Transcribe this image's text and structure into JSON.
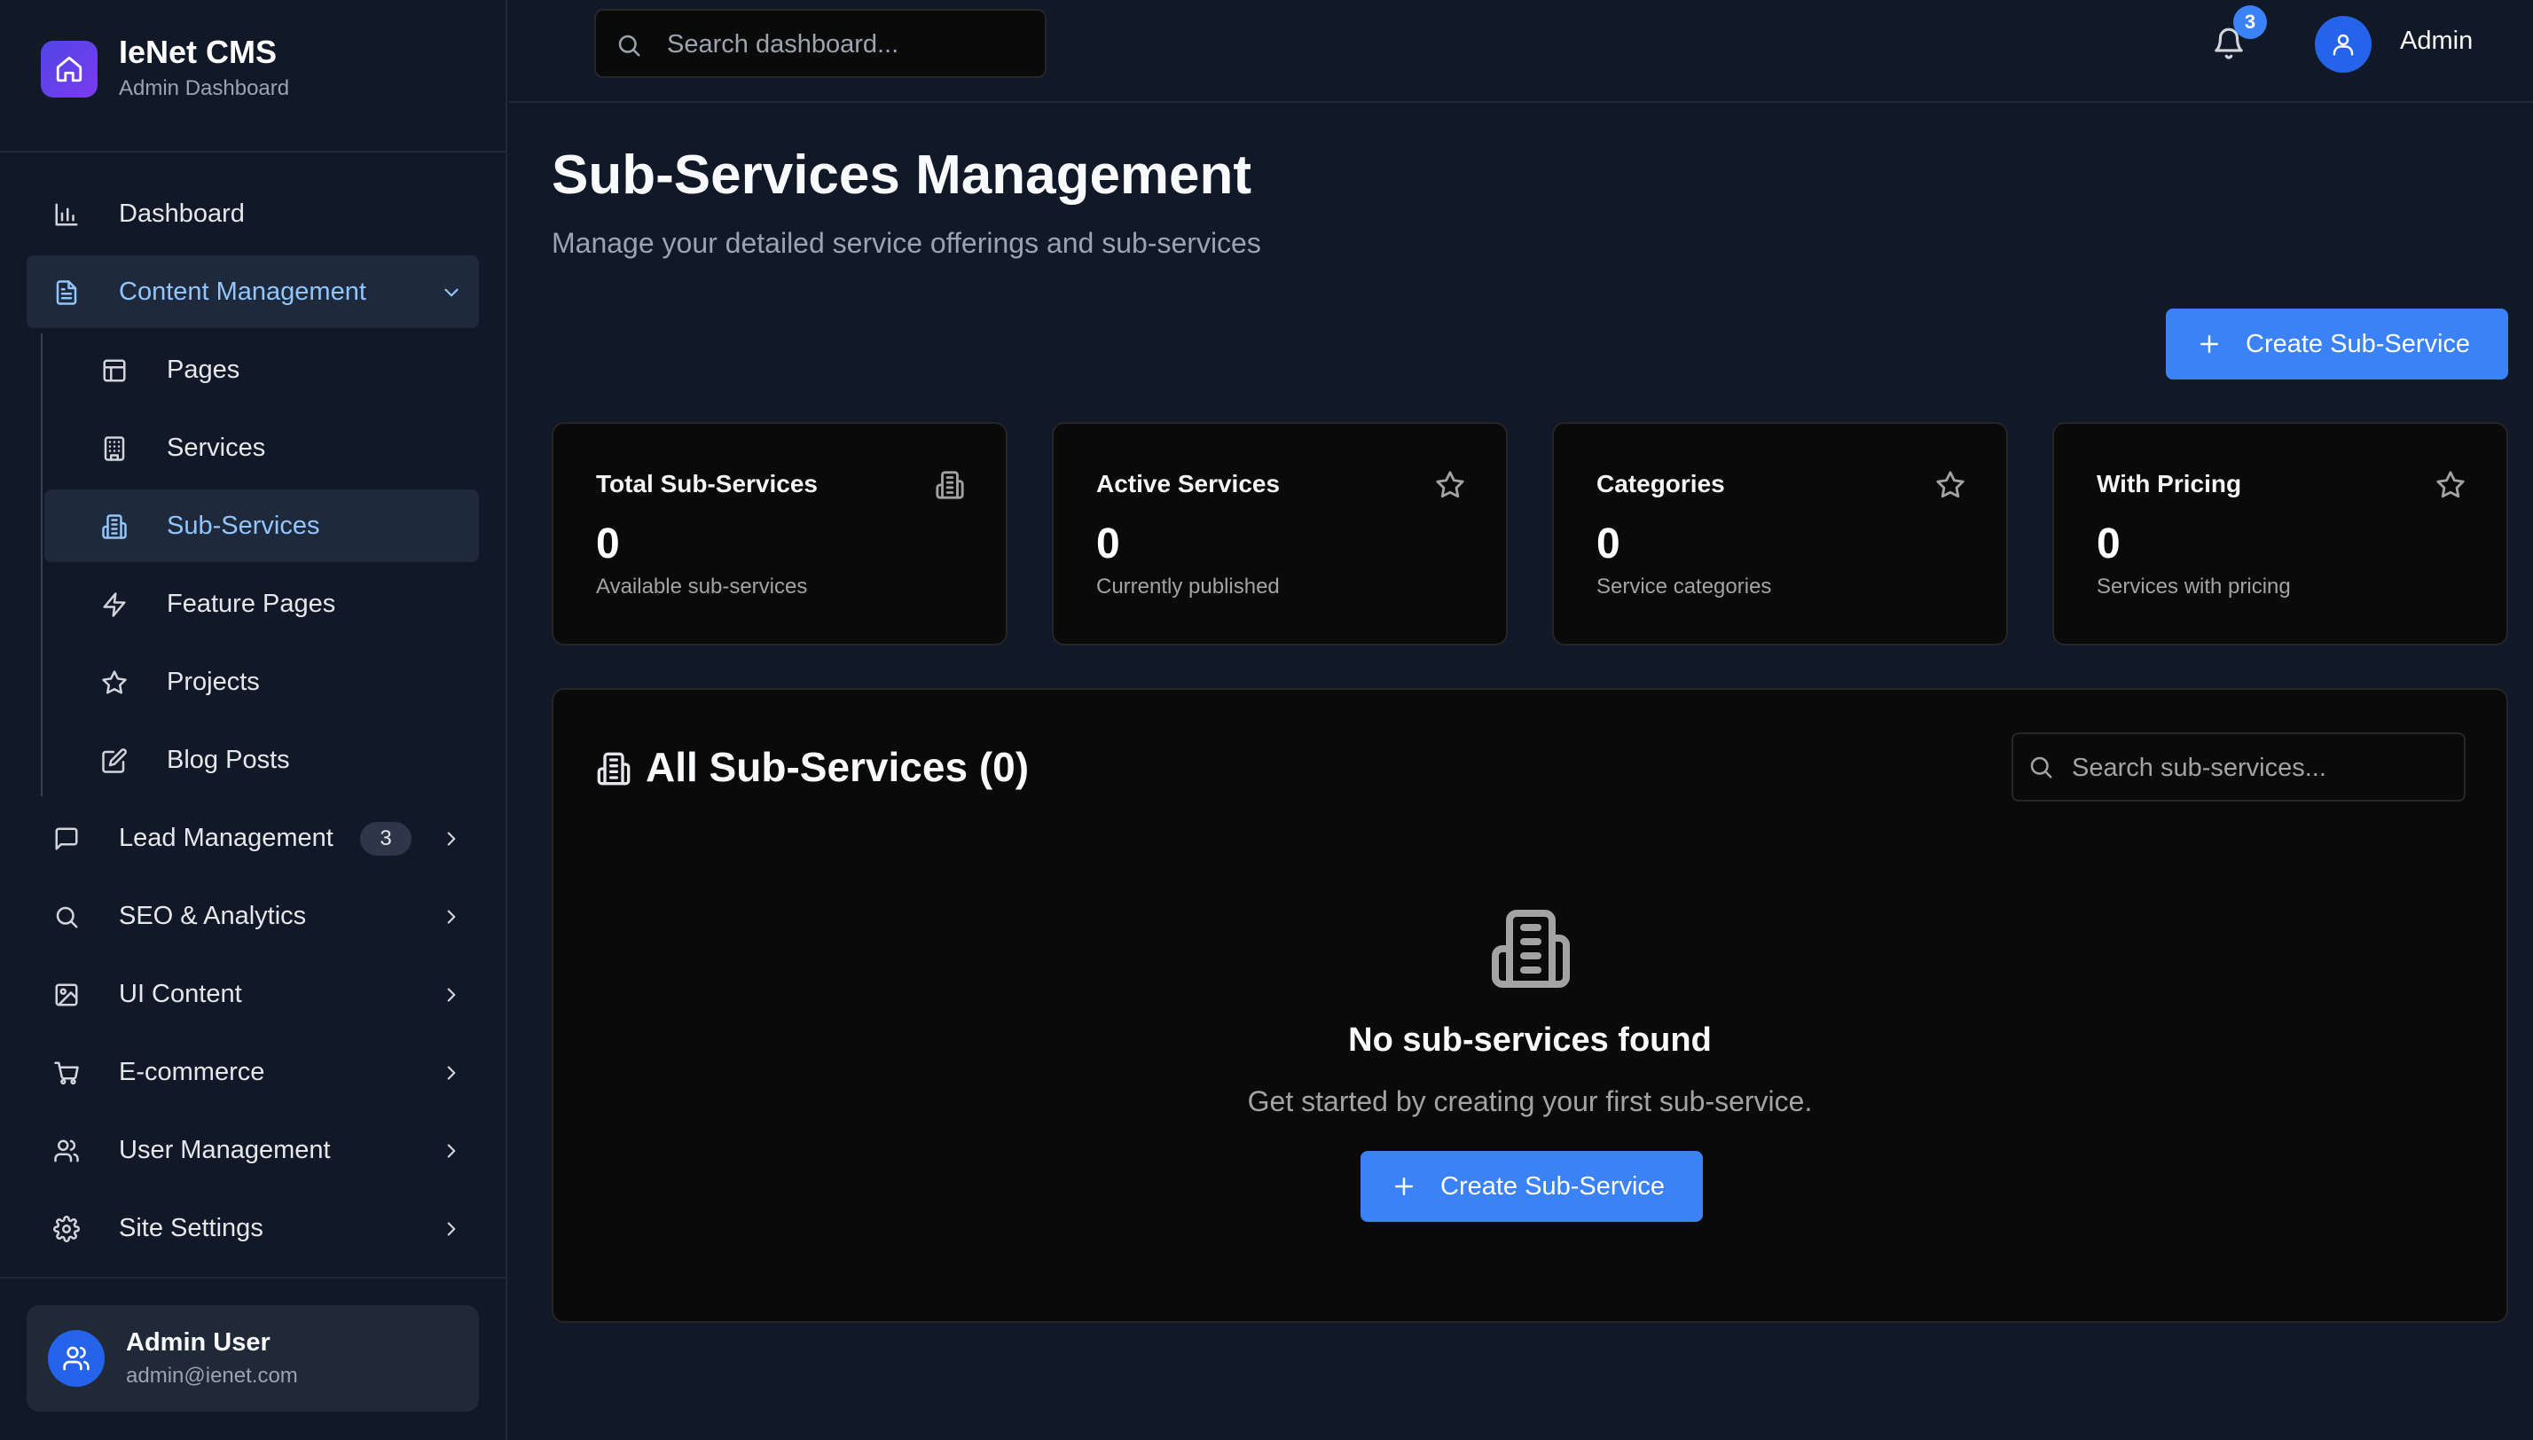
{
  "brand": {
    "name": "IeNet CMS",
    "subtitle": "Admin Dashboard"
  },
  "sidebar": {
    "items": [
      {
        "label": "Dashboard",
        "icon": "bar-chart-icon"
      },
      {
        "label": "Content Management",
        "icon": "file-text-icon",
        "expanded": true,
        "children": [
          {
            "label": "Pages",
            "icon": "layout-icon"
          },
          {
            "label": "Services",
            "icon": "building-icon"
          },
          {
            "label": "Sub-Services",
            "icon": "building-2-icon",
            "active": true
          },
          {
            "label": "Feature Pages",
            "icon": "zap-icon"
          },
          {
            "label": "Projects",
            "icon": "star-icon"
          },
          {
            "label": "Blog Posts",
            "icon": "edit-icon"
          }
        ]
      },
      {
        "label": "Lead Management",
        "icon": "message-square-icon",
        "badge": "3"
      },
      {
        "label": "SEO & Analytics",
        "icon": "search-icon"
      },
      {
        "label": "UI Content",
        "icon": "image-icon"
      },
      {
        "label": "E-commerce",
        "icon": "shopping-cart-icon"
      },
      {
        "label": "User Management",
        "icon": "users-icon"
      },
      {
        "label": "Site Settings",
        "icon": "gear-icon"
      }
    ],
    "user": {
      "name": "Admin User",
      "email": "admin@ienet.com"
    }
  },
  "header": {
    "search_placeholder": "Search dashboard...",
    "notification_count": "3",
    "user_name": "Admin"
  },
  "main": {
    "title": "Sub-Services Management",
    "subtitle": "Manage your detailed service offerings and sub-services",
    "create_button": "Create Sub-Service",
    "stats": [
      {
        "title": "Total Sub-Services",
        "value": "0",
        "desc": "Available sub-services",
        "icon": "building-2-icon"
      },
      {
        "title": "Active Services",
        "value": "0",
        "desc": "Currently published",
        "icon": "star-icon"
      },
      {
        "title": "Categories",
        "value": "0",
        "desc": "Service categories",
        "icon": "star-icon"
      },
      {
        "title": "With Pricing",
        "value": "0",
        "desc": "Services with pricing",
        "icon": "star-icon"
      }
    ],
    "list": {
      "title": "All Sub-Services (0)",
      "search_placeholder": "Search sub-services...",
      "empty_title": "No sub-services found",
      "empty_sub": "Get started by creating your first sub-service.",
      "empty_button": "Create Sub-Service"
    }
  },
  "colors": {
    "accent": "#3b82f6",
    "background": "#111827",
    "card": "#0a0a0a",
    "active_nav": "#1e293b"
  }
}
